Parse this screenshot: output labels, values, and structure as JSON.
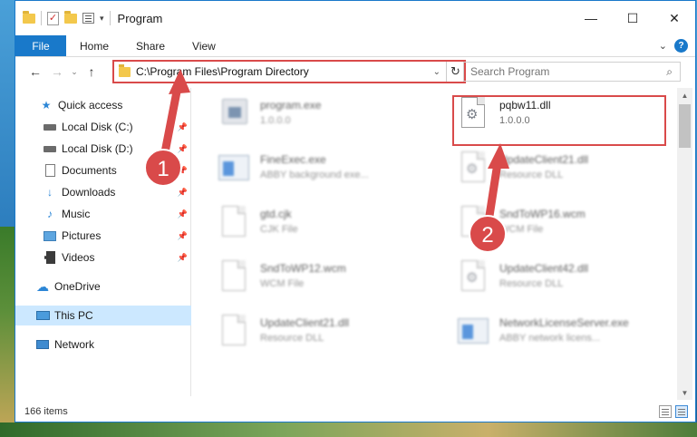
{
  "window": {
    "title": "Program",
    "minimize": "—",
    "maximize": "☐",
    "close": "✕"
  },
  "ribbon": {
    "tabs": [
      "File",
      "Home",
      "Share",
      "View"
    ],
    "help": "?"
  },
  "address": {
    "path": "C:\\Program Files\\Program Directory"
  },
  "search": {
    "placeholder": "Search Program"
  },
  "sidebar": {
    "items": [
      {
        "label": "Quick access",
        "icon": "star-icon"
      },
      {
        "label": "Local Disk (C:)",
        "icon": "drive-icon",
        "pinned": true
      },
      {
        "label": "Local Disk (D:)",
        "icon": "drive-icon",
        "pinned": true
      },
      {
        "label": "Documents",
        "icon": "documents-icon",
        "pinned": true
      },
      {
        "label": "Downloads",
        "icon": "download-icon",
        "pinned": true
      },
      {
        "label": "Music",
        "icon": "music-icon",
        "pinned": true
      },
      {
        "label": "Pictures",
        "icon": "pictures-icon",
        "pinned": true
      },
      {
        "label": "Videos",
        "icon": "videos-icon",
        "pinned": true
      },
      {
        "label": "OneDrive",
        "icon": "cloud-icon"
      },
      {
        "label": "This PC",
        "icon": "computer-icon",
        "selected": true
      },
      {
        "label": "Network",
        "icon": "network-icon"
      }
    ]
  },
  "files": [
    {
      "name": "program.exe",
      "sub": "1.0.0.0",
      "icon": "exe-icon",
      "blur": true
    },
    {
      "name": "pqbw11.dll",
      "sub": "1.0.0.0",
      "icon": "dll-gears-icon",
      "blur": false
    },
    {
      "name": "FineExec.exe",
      "sub": "ABBY background exe...",
      "icon": "app-window-icon",
      "blur": true
    },
    {
      "name": "UpdateClient21.dll",
      "sub": "Resource DLL",
      "icon": "dll-gears-icon",
      "blur": true
    },
    {
      "name": "gtd.cjk",
      "sub": "CJK File",
      "icon": "blank-file-icon",
      "blur": true
    },
    {
      "name": "SndToWP16.wcm",
      "sub": "WCM File",
      "icon": "blank-file-icon",
      "blur": true
    },
    {
      "name": "SndToWP12.wcm",
      "sub": "WCM File",
      "icon": "blank-file-icon",
      "blur": true
    },
    {
      "name": "UpdateClient42.dll",
      "sub": "Resource DLL",
      "icon": "dll-gears-icon",
      "blur": true
    },
    {
      "name": "UpdateClient21.dll",
      "sub": "Resource DLL",
      "icon": "blank-file-icon",
      "blur": true
    },
    {
      "name": "NetworkLicenseServer.exe",
      "sub": "ABBY network licens...",
      "icon": "app-window-icon",
      "blur": true
    }
  ],
  "status": {
    "item_count": "166 items"
  },
  "annotations": {
    "badge1": "1",
    "badge2": "2",
    "color": "#d94a4a"
  }
}
